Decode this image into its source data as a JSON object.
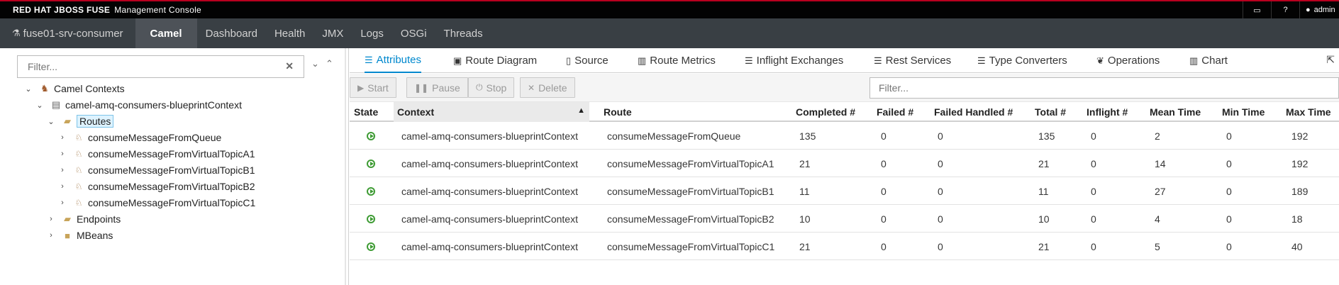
{
  "app": {
    "brand": "RED HAT JBOSS FUSE",
    "subtitle": "Management Console",
    "user": "admin"
  },
  "nav": {
    "context": "fuse01-srv-consumer",
    "items": [
      "Camel",
      "Dashboard",
      "Health",
      "JMX",
      "Logs",
      "OSGi",
      "Threads"
    ],
    "active": "Camel"
  },
  "tree": {
    "filter_placeholder": "Filter...",
    "root": "Camel Contexts",
    "context": "camel-amq-consumers-blueprintContext",
    "routes_label": "Routes",
    "routes": [
      "consumeMessageFromQueue",
      "consumeMessageFromVirtualTopicA1",
      "consumeMessageFromVirtualTopicB1",
      "consumeMessageFromVirtualTopicB2",
      "consumeMessageFromVirtualTopicC1"
    ],
    "endpoints_label": "Endpoints",
    "mbeans_label": "MBeans"
  },
  "tabs": [
    "Attributes",
    "Route Diagram",
    "Source",
    "Route Metrics",
    "Inflight Exchanges",
    "Rest Services",
    "Type Converters",
    "Operations",
    "Chart"
  ],
  "active_tab": "Attributes",
  "toolbar": {
    "start": "Start",
    "pause": "Pause",
    "stop": "Stop",
    "delete": "Delete",
    "filter_placeholder": "Filter..."
  },
  "table": {
    "columns": [
      "State",
      "Context",
      "Route",
      "Completed #",
      "Failed #",
      "Failed Handled #",
      "Total #",
      "Inflight #",
      "Mean Time",
      "Min Time",
      "Max Time"
    ],
    "rows": [
      [
        "camel-amq-consumers-blueprintContext",
        "consumeMessageFromQueue",
        "135",
        "0",
        "0",
        "135",
        "0",
        "2",
        "0",
        "192"
      ],
      [
        "camel-amq-consumers-blueprintContext",
        "consumeMessageFromVirtualTopicA1",
        "21",
        "0",
        "0",
        "21",
        "0",
        "14",
        "0",
        "192"
      ],
      [
        "camel-amq-consumers-blueprintContext",
        "consumeMessageFromVirtualTopicB1",
        "11",
        "0",
        "0",
        "11",
        "0",
        "27",
        "0",
        "189"
      ],
      [
        "camel-amq-consumers-blueprintContext",
        "consumeMessageFromVirtualTopicB2",
        "10",
        "0",
        "0",
        "10",
        "0",
        "4",
        "0",
        "18"
      ],
      [
        "camel-amq-consumers-blueprintContext",
        "consumeMessageFromVirtualTopicC1",
        "21",
        "0",
        "0",
        "21",
        "0",
        "5",
        "0",
        "40"
      ]
    ]
  }
}
